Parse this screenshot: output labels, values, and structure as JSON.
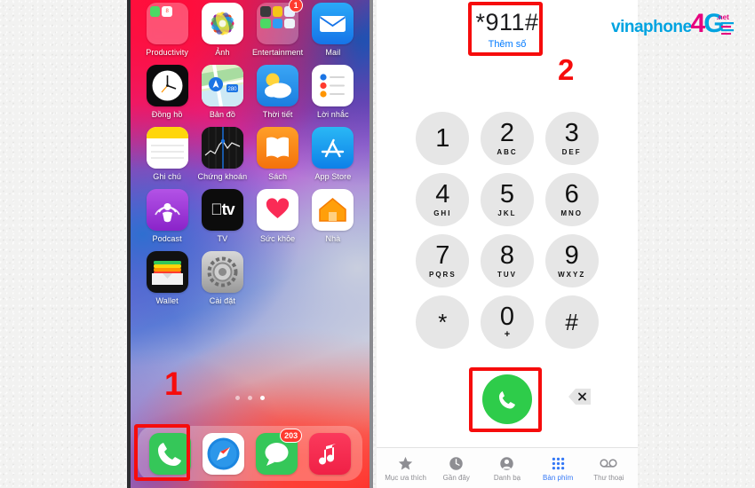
{
  "background": {
    "color": "#f2f2f1"
  },
  "brand_logo": {
    "part1": "vinaphone",
    "part2": "4",
    "part3": "G",
    "part4": ".net",
    "color_cyan": "#00a3e0",
    "color_magenta": "#e6007e"
  },
  "annotations": [
    {
      "id": "step-1",
      "label": "1",
      "target": "phone-app-dock-icon"
    },
    {
      "id": "step-2",
      "label": "2",
      "target": "dialed-number-field"
    }
  ],
  "home_screen": {
    "apps": [
      {
        "name": "Productivity",
        "label": "Productivity",
        "icon": "folder-icon",
        "badge": null
      },
      {
        "name": "Photos",
        "label": "Ảnh",
        "icon": "photos-icon",
        "badge": null
      },
      {
        "name": "Entertainment",
        "label": "Entertainment",
        "icon": "folder-icon",
        "badge": "1"
      },
      {
        "name": "Mail",
        "label": "Mail",
        "icon": "mail-icon",
        "badge": null
      },
      {
        "name": "Clock",
        "label": "Đồng hồ",
        "icon": "clock-icon",
        "badge": null
      },
      {
        "name": "Maps",
        "label": "Bản đồ",
        "icon": "maps-icon",
        "badge": null
      },
      {
        "name": "Weather",
        "label": "Thời tiết",
        "icon": "weather-icon",
        "badge": null
      },
      {
        "name": "Reminders",
        "label": "Lời nhắc",
        "icon": "reminders-icon",
        "badge": null
      },
      {
        "name": "Notes",
        "label": "Ghi chú",
        "icon": "notes-icon",
        "badge": null
      },
      {
        "name": "Stocks",
        "label": "Chứng khoán",
        "icon": "stocks-icon",
        "badge": null
      },
      {
        "name": "Books",
        "label": "Sách",
        "icon": "books-icon",
        "badge": null
      },
      {
        "name": "AppStore",
        "label": "App Store",
        "icon": "app-store-icon",
        "badge": null
      },
      {
        "name": "Podcasts",
        "label": "Podcast",
        "icon": "podcasts-icon",
        "badge": null
      },
      {
        "name": "TV",
        "label": "TV",
        "icon": "tv-icon",
        "badge": null
      },
      {
        "name": "Health",
        "label": "Sức khỏe",
        "icon": "health-icon",
        "badge": null
      },
      {
        "name": "Home",
        "label": "Nhà",
        "icon": "home-icon",
        "badge": null
      },
      {
        "name": "Wallet",
        "label": "Wallet",
        "icon": "wallet-icon",
        "badge": null
      },
      {
        "name": "Settings",
        "label": "Cài đặt",
        "icon": "settings-icon",
        "badge": null
      }
    ],
    "dock": [
      {
        "name": "Phone",
        "icon": "phone-icon",
        "badge": null
      },
      {
        "name": "Safari",
        "icon": "safari-icon",
        "badge": null
      },
      {
        "name": "Messages",
        "icon": "messages-icon",
        "badge": "203"
      },
      {
        "name": "Music",
        "icon": "music-icon",
        "badge": null
      }
    ],
    "page_dots": {
      "total": 3,
      "active_index": 2
    }
  },
  "dialer": {
    "number": "*911#",
    "add_number_label": "Thêm số",
    "add_number_color": "#007aff",
    "keys": [
      {
        "digit": "1",
        "letters": ""
      },
      {
        "digit": "2",
        "letters": "ABC"
      },
      {
        "digit": "3",
        "letters": "DEF"
      },
      {
        "digit": "4",
        "letters": "GHI"
      },
      {
        "digit": "5",
        "letters": "JKL"
      },
      {
        "digit": "6",
        "letters": "MNO"
      },
      {
        "digit": "7",
        "letters": "PQRS"
      },
      {
        "digit": "8",
        "letters": "TUV"
      },
      {
        "digit": "9",
        "letters": "WXYZ"
      },
      {
        "digit": "*",
        "letters": ""
      },
      {
        "digit": "0",
        "letters": "+"
      },
      {
        "digit": "#",
        "letters": ""
      }
    ],
    "call_button": {
      "icon": "phone-call-icon",
      "color": "#2ecc4a"
    },
    "backspace": {
      "icon": "backspace-icon"
    },
    "tabs": [
      {
        "label": "Mục ưa thích",
        "icon": "star-icon",
        "active": false
      },
      {
        "label": "Gần đây",
        "icon": "clock-icon",
        "active": false
      },
      {
        "label": "Danh bạ",
        "icon": "contact-icon",
        "active": false
      },
      {
        "label": "Bàn phím",
        "icon": "keypad-icon",
        "active": true
      },
      {
        "label": "Thư thoại",
        "icon": "voicemail-icon",
        "active": false
      }
    ],
    "active_tab_color": "#3478f6"
  }
}
